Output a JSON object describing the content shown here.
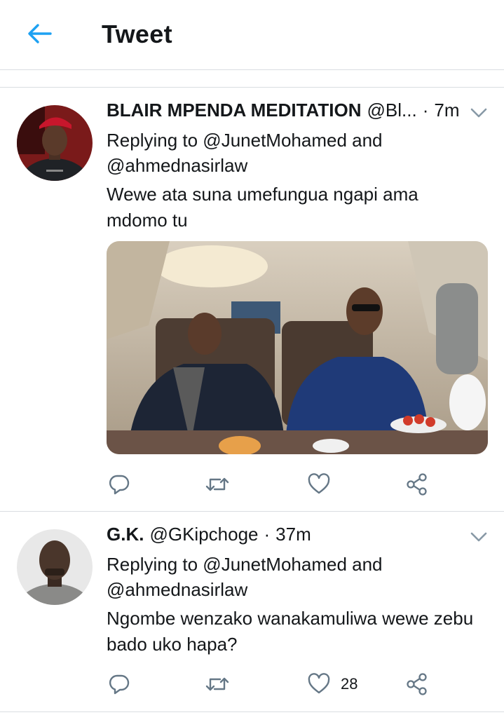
{
  "header": {
    "title": "Tweet",
    "back_icon": "arrow-left-icon",
    "accent": "#1da1f2"
  },
  "tweets": [
    {
      "name": "BLAIR MPENDA MEDITATION",
      "handle": "@Bl...",
      "time": "7m",
      "reply_line_1": "Replying to @JunetMohamed and",
      "reply_line_2": "@ahmednasirlaw",
      "text_line_1": "Wewe ata suna umefungua ngapi ama",
      "text_line_2": "mdomo tu",
      "has_media": true,
      "like_count": ""
    },
    {
      "name": "G.K.",
      "handle": "@GKipchoge",
      "time": "37m",
      "reply_line_1": "Replying to @JunetMohamed and",
      "reply_line_2": "@ahmednasirlaw",
      "text_line_1": "Ngombe wenzako wanakamuliwa wewe zebu",
      "text_line_2": "bado uko hapa?",
      "has_media": false,
      "like_count": "28"
    }
  ],
  "dot": "·",
  "icons": [
    "reply-icon",
    "retweet-icon",
    "like-icon",
    "share-icon",
    "chevron-down-icon"
  ],
  "colors": {
    "text": "#14171a",
    "icon": "#657786",
    "divider": "#d9dde1"
  }
}
